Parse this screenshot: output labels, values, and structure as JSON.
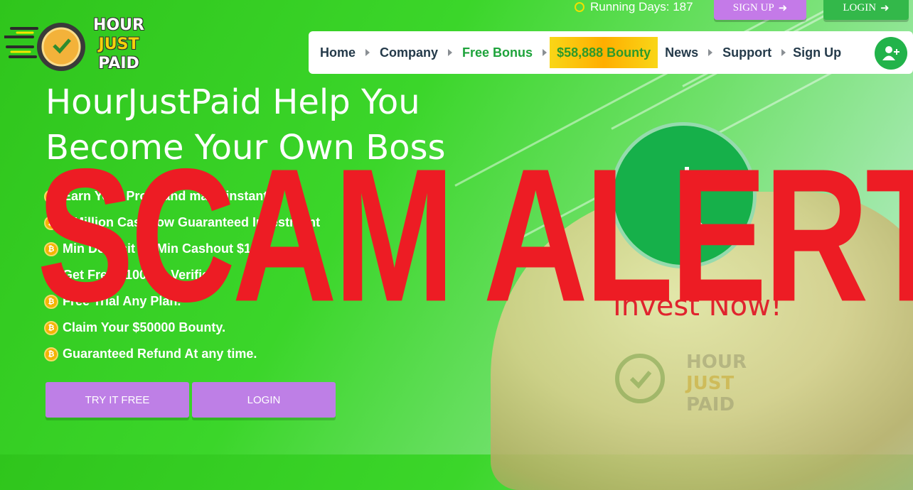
{
  "brand": {
    "line1": "HOUR",
    "line2": "JUST",
    "line3": "PAID"
  },
  "topbar": {
    "running_days": "Running Days: 187",
    "signup": "SIGN UP",
    "login": "LOGIN"
  },
  "nav": {
    "items": [
      {
        "label": "Home"
      },
      {
        "label": "Company"
      },
      {
        "label": "Free Bonus"
      },
      {
        "label": "$58,888 Bounty"
      },
      {
        "label": "News"
      },
      {
        "label": "Support"
      },
      {
        "label": "Sign Up"
      }
    ]
  },
  "hero": {
    "headline_1": "HourJustPaid Help You",
    "headline_2": "Become Your Own Boss",
    "features": [
      "Earn Your Profit and make instant",
      "1 Million Cashflow Guaranteed Investment",
      "Min Deposit $5,Min Cashout $1.",
      "Get Free $100 for Verified",
      "Free Trial Any Plan.",
      "Claim Your $50000 Bounty.",
      "Guaranteed Refund At any time."
    ],
    "try_button": "TRY IT FREE",
    "login_button": "LOGIN",
    "invest_now": "Invest Now!"
  },
  "overlay": {
    "text": "SCAM ALERT"
  },
  "colors": {
    "accent_green": "#3bd62a",
    "purple_button": "#be7fe6",
    "alert_red": "#ed1c24"
  }
}
